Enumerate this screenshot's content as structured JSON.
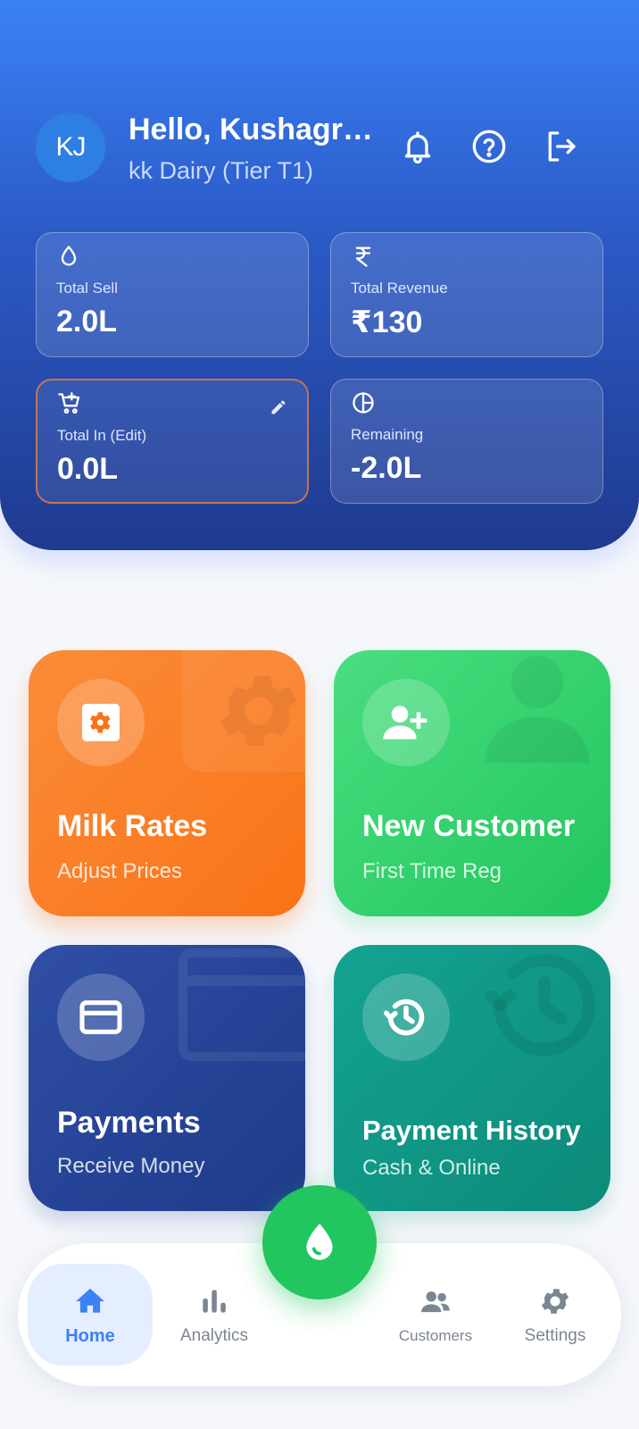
{
  "header": {
    "avatar_initials": "KJ",
    "greeting": "Hello, Kushagr…",
    "subtitle": "kk Dairy (Tier T1)",
    "icons": [
      "bell-icon",
      "help-icon",
      "logout-icon"
    ],
    "gradient_colors": [
      "#3b82f6",
      "#1f3a8f"
    ]
  },
  "stats": [
    {
      "icon": "droplet-icon",
      "label": "Total Sell",
      "value": "2.0L"
    },
    {
      "icon": "rupee-icon",
      "label": "Total Revenue",
      "value": "₹130"
    },
    {
      "icon": "cart-plus-icon",
      "label": "Total In (Edit)",
      "value": "0.0L",
      "editable": true
    },
    {
      "icon": "pie-chart-icon",
      "label": "Remaining",
      "value": "-2.0L"
    }
  ],
  "tiles": [
    {
      "title": "Milk Rates",
      "subtitle": "Adjust Prices",
      "icon": "settings-box-icon",
      "color": "#f97316"
    },
    {
      "title": "New Customer",
      "subtitle": "First Time Reg",
      "icon": "add-user-icon",
      "color": "#22c55e"
    },
    {
      "title": "Payments",
      "subtitle": "Receive Money",
      "icon": "credit-card-icon",
      "color": "#1e3a8a"
    },
    {
      "title": "Payment History",
      "subtitle": "Cash & Online",
      "icon": "history-icon",
      "color": "#0d8a7a"
    }
  ],
  "nav": {
    "items": [
      {
        "label": "Home",
        "icon": "home-icon",
        "active": true
      },
      {
        "label": "Analytics",
        "icon": "bar-chart-icon"
      },
      {
        "label": "Customers",
        "icon": "customers-icon"
      },
      {
        "label": "Settings",
        "icon": "gear-icon"
      }
    ],
    "fab_icon": "milk-drop-icon",
    "active_color": "#3b82f6",
    "fab_color": "#22c55e"
  }
}
